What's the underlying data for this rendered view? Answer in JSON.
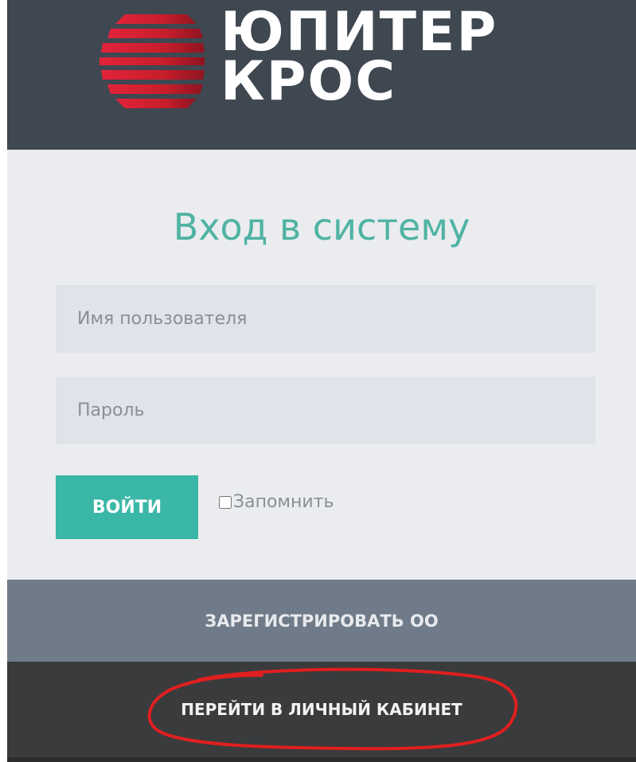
{
  "header": {
    "logo_line1": "ЮПИТЕР",
    "logo_line2": "КРОС",
    "logo_icon": "stacked-stripes-logo-icon",
    "logo_color": "#c81e2b"
  },
  "login": {
    "title": "Вход в систему",
    "username_placeholder": "Имя пользователя",
    "username_value": "",
    "password_placeholder": "Пароль",
    "password_value": "",
    "submit_label": "ВОЙТИ",
    "remember_label": "Запомнить",
    "remember_checked": false
  },
  "footer": {
    "register_label": "ЗАРЕГИСТРИРОВАТЬ ОО",
    "cabinet_label": "ПЕРЕЙТИ В ЛИЧНЫЙ КАБИНЕТ"
  },
  "colors": {
    "header_bg": "#3f4750",
    "title_accent": "#4fb3a3",
    "button_bg": "#3bb7a7",
    "register_bg": "#6f7b88",
    "cabinet_bg": "#3a3b3c",
    "annotation": "#e01f1f"
  }
}
